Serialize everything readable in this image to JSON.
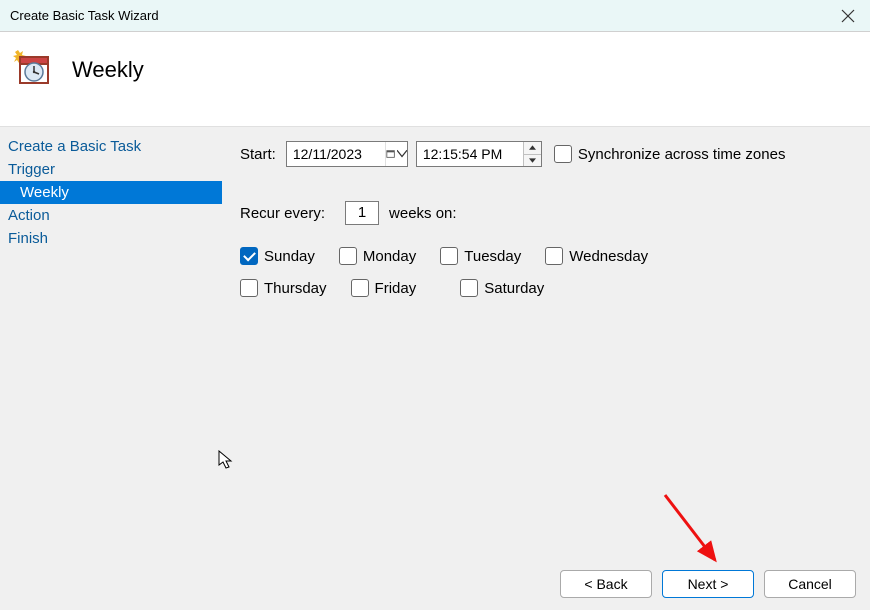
{
  "window": {
    "title": "Create Basic Task Wizard"
  },
  "header": {
    "page_title": "Weekly"
  },
  "sidebar": {
    "items": [
      {
        "label": "Create a Basic Task",
        "selected": false,
        "sub": false
      },
      {
        "label": "Trigger",
        "selected": false,
        "sub": false
      },
      {
        "label": "Weekly",
        "selected": true,
        "sub": true
      },
      {
        "label": "Action",
        "selected": false,
        "sub": false
      },
      {
        "label": "Finish",
        "selected": false,
        "sub": false
      }
    ]
  },
  "content": {
    "start_label": "Start:",
    "date_value": "12/11/2023",
    "time_value": "12:15:54 PM",
    "sync_tz_label": "Synchronize across time zones",
    "sync_tz_checked": false,
    "recur_label_left": "Recur every:",
    "recur_value": "1",
    "recur_label_right": "weeks on:",
    "days_row1": [
      {
        "label": "Sunday",
        "checked": true
      },
      {
        "label": "Monday",
        "checked": false
      },
      {
        "label": "Tuesday",
        "checked": false
      },
      {
        "label": "Wednesday",
        "checked": false
      }
    ],
    "days_row2": [
      {
        "label": "Thursday",
        "checked": false
      },
      {
        "label": "Friday",
        "checked": false
      },
      {
        "label": "Saturday",
        "checked": false
      }
    ]
  },
  "footer": {
    "back": "< Back",
    "next": "Next >",
    "cancel": "Cancel"
  }
}
